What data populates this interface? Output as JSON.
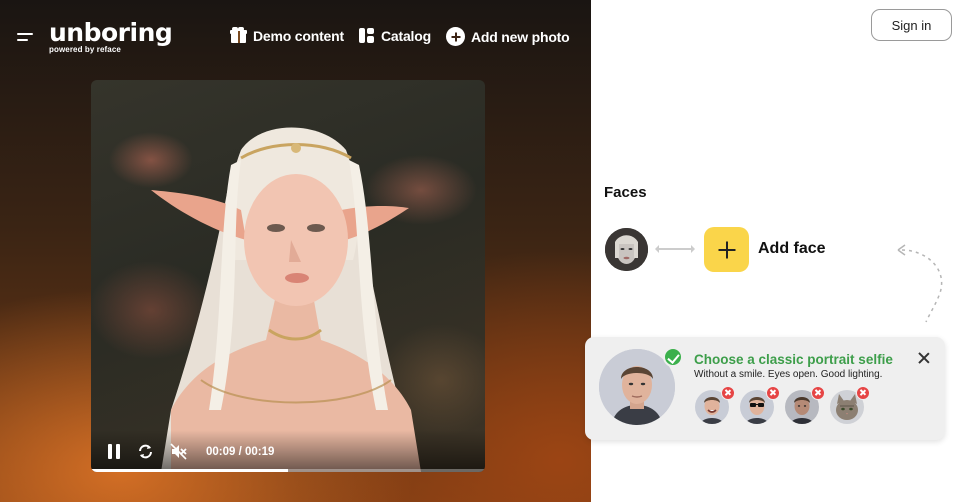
{
  "header": {
    "logo_word": "unboring",
    "logo_tagline": "powered by reface",
    "nav": {
      "demo": "Demo content",
      "catalog": "Catalog",
      "add_photo": "Add new photo"
    }
  },
  "player": {
    "time": "00:09 / 00:19",
    "progress": 0.5
  },
  "auth": {
    "signin_label": "Sign in"
  },
  "faces": {
    "title": "Faces",
    "add_face_label": "Add face"
  },
  "tip": {
    "title": "Choose a classic portrait selfie",
    "subtitle": "Without a smile. Eyes open. Good lighting."
  },
  "icons": [
    "menu-icon",
    "gift-icon",
    "catalog-icon",
    "plus-circle-icon",
    "pause-icon",
    "repeat-icon",
    "mute-icon",
    "plus-icon",
    "check-icon",
    "close-icon",
    "x-badge-icon"
  ],
  "colors": {
    "accent_yellow": "#fad54a",
    "success_green": "#3d9e4a",
    "error_red": "#e64545"
  }
}
